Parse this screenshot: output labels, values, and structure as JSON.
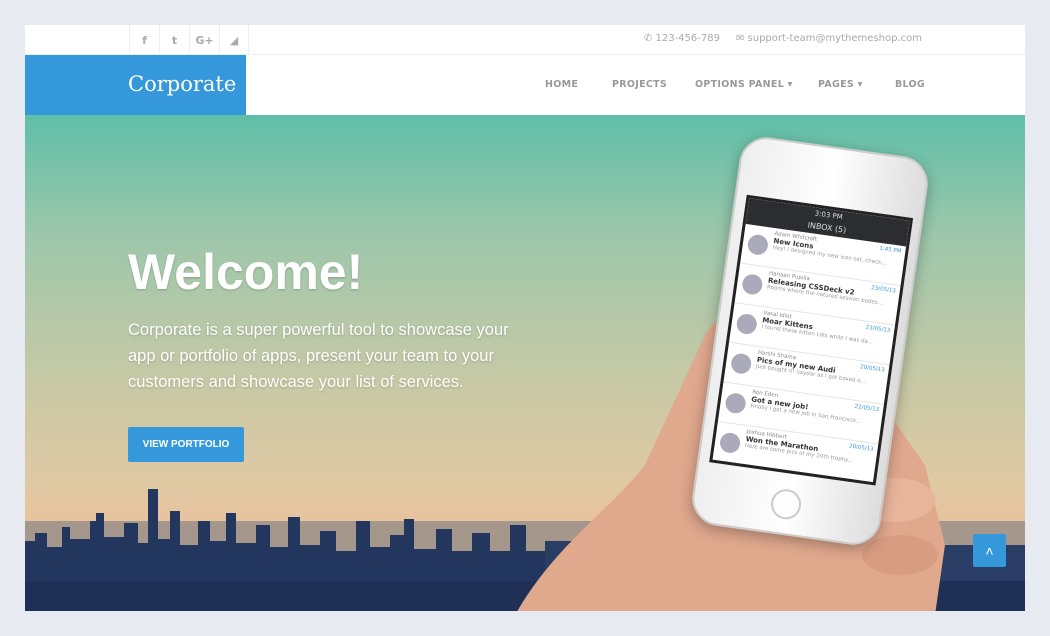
{
  "topbar": {
    "social": [
      {
        "icon": "facebook-icon",
        "glyph": "f"
      },
      {
        "icon": "twitter-icon",
        "glyph": "t"
      },
      {
        "icon": "google-plus-icon",
        "glyph": "G+"
      },
      {
        "icon": "rss-icon",
        "glyph": "◢"
      }
    ],
    "phone": "123-456-789",
    "email": "support-team@mythemeshop.com"
  },
  "nav": {
    "logo": "Corporate",
    "items": [
      "HOME",
      "PROJECTS",
      "OPTIONS PANEL ▾",
      "PAGES ▾",
      "BLOG"
    ]
  },
  "hero": {
    "title": "Welcome!",
    "description": "Corporate is a super powerful tool to showcase your app or portfolio of apps, present your team to your customers and showcase your list of services.",
    "button": "VIEW PORTFOLIO"
  },
  "phone_screen": {
    "time": "3:03 PM",
    "header": "INBOX (5)",
    "messages": [
      {
        "name": "Adam Whitcroft",
        "subject": "New Icons",
        "time": "1:45 PM",
        "preview": "Hey! I designed my new icon set, check..."
      },
      {
        "name": "Hanaan Pupilla",
        "subject": "Releasing CSSDeck v2",
        "time": "23/05/13",
        "preview": "Rooms where the natured session bodes..."
      },
      {
        "name": "Vasal Idiot",
        "subject": "Moar Kittens",
        "time": "23/05/13",
        "preview": "I found these kitten LIKs while I was da..."
      },
      {
        "name": "Harshi Shama",
        "subject": "Pics of my new Audi",
        "time": "20/05/13",
        "preview": "Just bought it! Saydar as I got boxed o..."
      },
      {
        "name": "Ron Eden",
        "subject": "Got a new job!",
        "time": "22/05/13",
        "preview": "Finally I got a new job in San Francisco..."
      },
      {
        "name": "Joshua Hibbert",
        "subject": "Won the Marathon",
        "time": "20/05/13",
        "preview": "Here are some pics of my 20th trophy..."
      }
    ]
  },
  "scroll_top": {
    "icon": "chevron-up-icon",
    "glyph": "˄"
  },
  "colors": {
    "accent": "#3498db",
    "background": "#e8eaf1"
  }
}
